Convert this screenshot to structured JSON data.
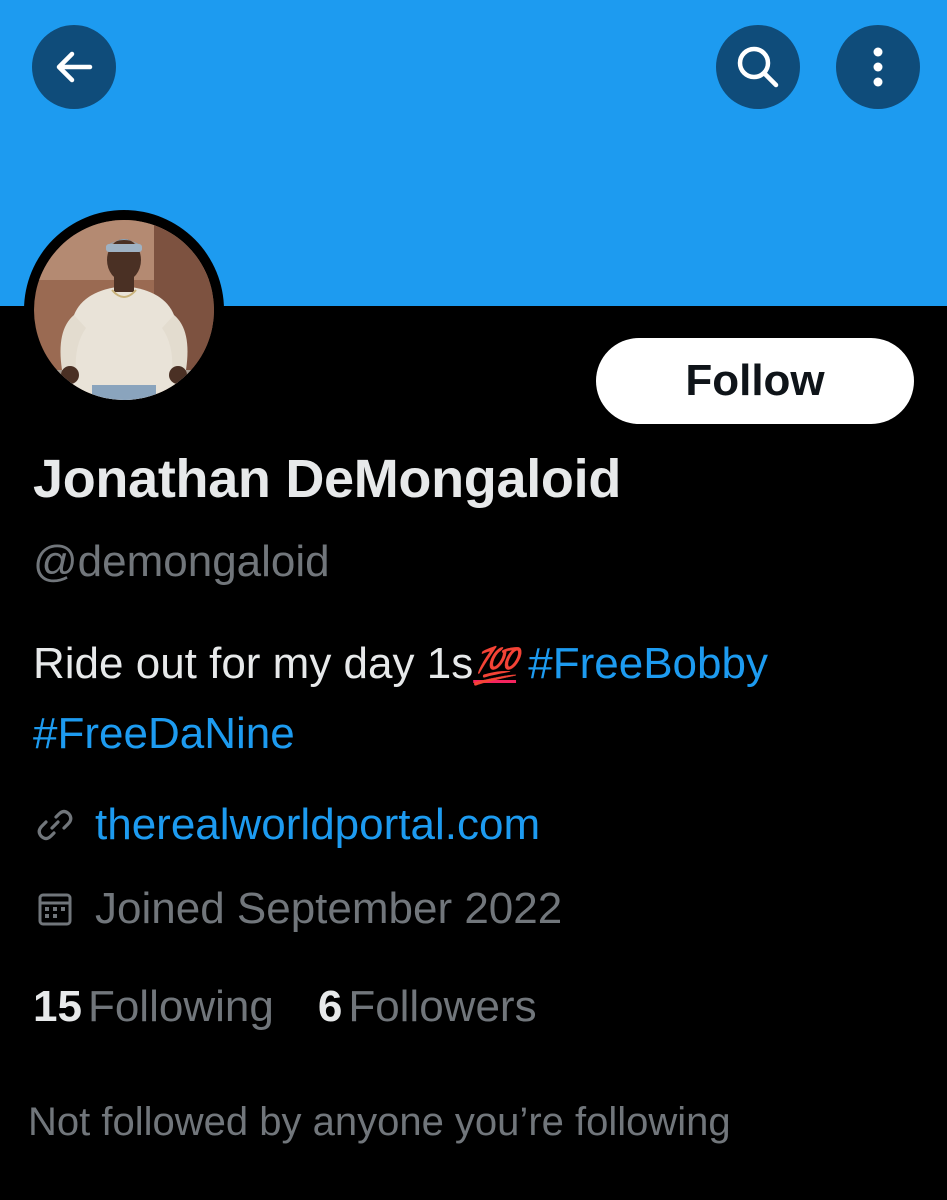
{
  "header": {
    "back_icon": "arrow-left-icon",
    "search_icon": "search-icon",
    "more_icon": "more-vertical-icon",
    "banner_color": "#1d9bf0",
    "button_bg": "#0f4c7a"
  },
  "profile": {
    "display_name": "Jonathan DeMongaloid",
    "handle": "@demongaloid",
    "follow_label": "Follow",
    "bio": {
      "text": "Ride out for my day 1s",
      "emoji": "💯",
      "hashtags": [
        "#FreeBobby",
        "#FreeDaNine"
      ]
    },
    "website_icon": "link-icon",
    "website": "therealworldportal.com",
    "joined_icon": "calendar-icon",
    "joined": "Joined September 2022",
    "stats": {
      "following_count": "15",
      "following_label": "Following",
      "followers_count": "6",
      "followers_label": "Followers"
    },
    "mutuals_note": "Not followed by anyone you’re following"
  },
  "colors": {
    "accent": "#1d9bf0",
    "text_primary": "#e7e9ea",
    "text_secondary": "#71767b",
    "background": "#000000"
  }
}
